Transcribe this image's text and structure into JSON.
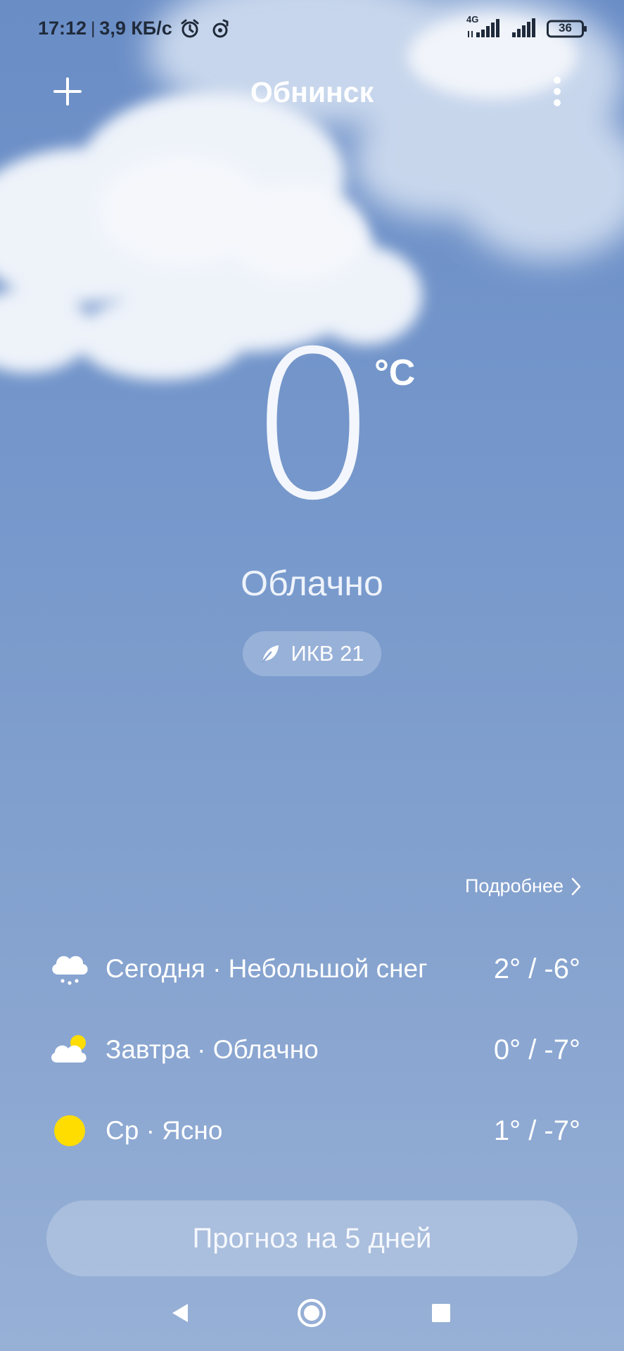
{
  "status_bar": {
    "time": "17:12",
    "separator": "|",
    "data_rate": "3,9 КБ/с",
    "network_type": "4G",
    "battery_level": "36"
  },
  "header": {
    "city": "Обнинск"
  },
  "current": {
    "temperature": "0",
    "unit": "°C",
    "condition": "Облачно",
    "aqi_label": "ИКВ 21"
  },
  "details_link": "Подробнее",
  "forecast": [
    {
      "label": "Сегодня · Небольшой снег",
      "temps": "2° / -6°",
      "icon": "snow-cloud-icon"
    },
    {
      "label": "Завтра · Облачно",
      "temps": "0° / -7°",
      "icon": "partly-cloudy-icon"
    },
    {
      "label": "Ср · Ясно",
      "temps": "1° / -7°",
      "icon": "sun-icon"
    }
  ],
  "cta_label": "Прогноз на 5 дней",
  "colors": {
    "sky_top": "#6a8dc6",
    "sky_bottom": "#97b0d6",
    "sun": "#ffdd00"
  }
}
